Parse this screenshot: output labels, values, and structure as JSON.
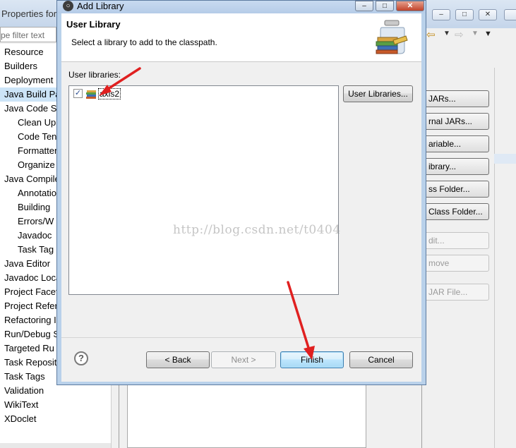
{
  "background_window": {
    "title": "Properties for",
    "filter_placeholder": "pe filter text",
    "tree_items": [
      {
        "label": "Resource",
        "level": 0
      },
      {
        "label": "Builders",
        "level": 0
      },
      {
        "label": "Deployment",
        "level": 0
      },
      {
        "label": "Java Build Pa",
        "level": 0,
        "selected": true
      },
      {
        "label": "Java Code St",
        "level": 0
      },
      {
        "label": "Clean Up",
        "level": 1
      },
      {
        "label": "Code Ten",
        "level": 1
      },
      {
        "label": "Formatter",
        "level": 1
      },
      {
        "label": "Organize",
        "level": 1
      },
      {
        "label": "Java Compile",
        "level": 0
      },
      {
        "label": "Annotatio",
        "level": 1
      },
      {
        "label": "Building",
        "level": 1
      },
      {
        "label": "Errors/W",
        "level": 1
      },
      {
        "label": "Javadoc",
        "level": 1
      },
      {
        "label": "Task Tag",
        "level": 1
      },
      {
        "label": "Java Editor",
        "level": 0
      },
      {
        "label": "Javadoc Loca",
        "level": 0
      },
      {
        "label": "Project Facet",
        "level": 0
      },
      {
        "label": "Project Refer",
        "level": 0
      },
      {
        "label": "Refactoring I",
        "level": 0
      },
      {
        "label": "Run/Debug S",
        "level": 0
      },
      {
        "label": "Targeted Ru",
        "level": 0
      },
      {
        "label": "Task Reposit",
        "level": 0
      },
      {
        "label": "Task Tags",
        "level": 0
      },
      {
        "label": "Validation",
        "level": 0
      },
      {
        "label": "WikiText",
        "level": 0
      },
      {
        "label": "XDoclet",
        "level": 0
      }
    ],
    "side_buttons": [
      {
        "label": "JARs...",
        "enabled": true
      },
      {
        "label": "rnal JARs...",
        "enabled": true
      },
      {
        "label": "ariable...",
        "enabled": true
      },
      {
        "label": "ibrary...",
        "enabled": true
      },
      {
        "label": "ss Folder...",
        "enabled": true
      },
      {
        "label": "Class Folder...",
        "enabled": true
      },
      {
        "label": "dit...",
        "enabled": false
      },
      {
        "label": "move",
        "enabled": false
      },
      {
        "label": "JAR File...",
        "enabled": false
      }
    ]
  },
  "dialog": {
    "title": "Add Library",
    "heading": "User Library",
    "description": "Select a library to add to the classpath.",
    "list_label": "User libraries:",
    "libraries": [
      {
        "name": "axis2",
        "checked": true
      }
    ],
    "user_libraries_button": "User Libraries...",
    "help_glyph": "?",
    "back_button": "< Back",
    "next_button": "Next >",
    "finish_button": "Finish",
    "cancel_button": "Cancel"
  },
  "watermark": "http://blog.csdn.net/t0404",
  "colors": {
    "annotation_arrow": "#e02020",
    "dialog_frame": "#b9d1ea",
    "default_button_border": "#3c7fb1"
  }
}
